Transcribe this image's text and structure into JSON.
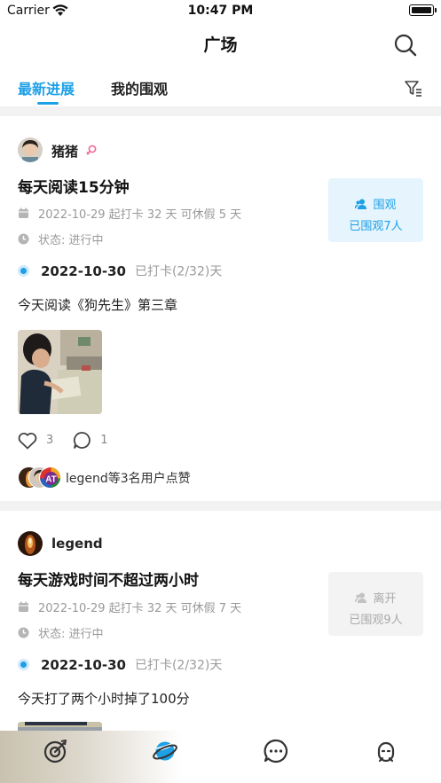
{
  "status_bar": {
    "carrier": "Carrier",
    "time": "10:47 PM"
  },
  "header": {
    "title": "广场"
  },
  "tabs": [
    {
      "label": "最新进展",
      "active": true
    },
    {
      "label": "我的围观",
      "active": false
    }
  ],
  "colors": {
    "accent": "#1ea0e6",
    "divider": "#f2f2f2",
    "gender_female": "#f06a9a"
  },
  "posts": [
    {
      "username": "猪猪",
      "gender_icon": "female-icon",
      "goal_title": "每天阅读15分钟",
      "meta": "2022-10-29 起打卡 32 天 可休假 5 天",
      "status": "状态: 进行中",
      "checkin_date": "2022-10-30",
      "checkin_status": "已打卡(2/32)天",
      "content": "今天阅读《狗先生》第三章",
      "watch": {
        "label": "围观",
        "count_text": "已围观7人",
        "icon": "watch-person-icon"
      },
      "likes": "3",
      "comments": "1",
      "likers_text": "legend等3名用户点赞",
      "liker_badge": "AT"
    },
    {
      "username": "legend",
      "goal_title": "每天游戏时间不超过两小时",
      "meta": "2022-10-29 起打卡 32 天 可休假 7 天",
      "status": "状态: 进行中",
      "checkin_date": "2022-10-30",
      "checkin_status": "已打卡(2/32)天",
      "content": "今天打了两个小时掉了100分",
      "watch": {
        "label": "离开",
        "count_text": "已围观9人",
        "icon": "leave-person-icon"
      }
    }
  ],
  "tabbar": [
    {
      "icon": "target-icon",
      "active": false
    },
    {
      "icon": "planet-icon",
      "active": true
    },
    {
      "icon": "chat-bubble-icon",
      "active": false
    },
    {
      "icon": "profile-icon",
      "active": false
    }
  ]
}
